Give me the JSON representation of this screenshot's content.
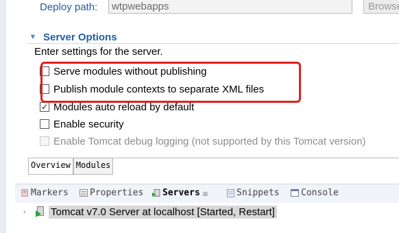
{
  "deploy": {
    "label": "Deploy path:",
    "value": "wtpwebapps",
    "browse_label": "Browse"
  },
  "server_options": {
    "title": "Server Options",
    "description": "Enter settings for the server.",
    "options": [
      {
        "label": "Serve modules without publishing",
        "checked": false,
        "enabled": true
      },
      {
        "label": "Publish module contexts to separate XML files",
        "checked": false,
        "enabled": true
      },
      {
        "label": "Modules auto reload by default",
        "checked": true,
        "enabled": true
      },
      {
        "label": "Enable security",
        "checked": false,
        "enabled": true
      },
      {
        "label": "Enable Tomcat debug logging (not supported by this Tomcat version)",
        "checked": false,
        "enabled": false
      }
    ]
  },
  "editor_tabs": [
    {
      "label": "Overview",
      "active": true
    },
    {
      "label": "Modules",
      "active": false
    }
  ],
  "views": [
    {
      "label": "Markers",
      "icon": "markers-icon",
      "active": false
    },
    {
      "label": "Properties",
      "icon": "properties-icon",
      "active": false
    },
    {
      "label": "Servers",
      "icon": "servers-icon",
      "active": true,
      "close": "☒"
    },
    {
      "label": "Snippets",
      "icon": "snippets-icon",
      "active": false
    },
    {
      "label": "Console",
      "icon": "console-icon",
      "active": false
    }
  ],
  "servers": [
    {
      "label": "Tomcat v7.0 Server at localhost  [Started, Restart]"
    }
  ],
  "colors": {
    "accent": "#1f5fa8",
    "highlight": "#e0201c"
  }
}
